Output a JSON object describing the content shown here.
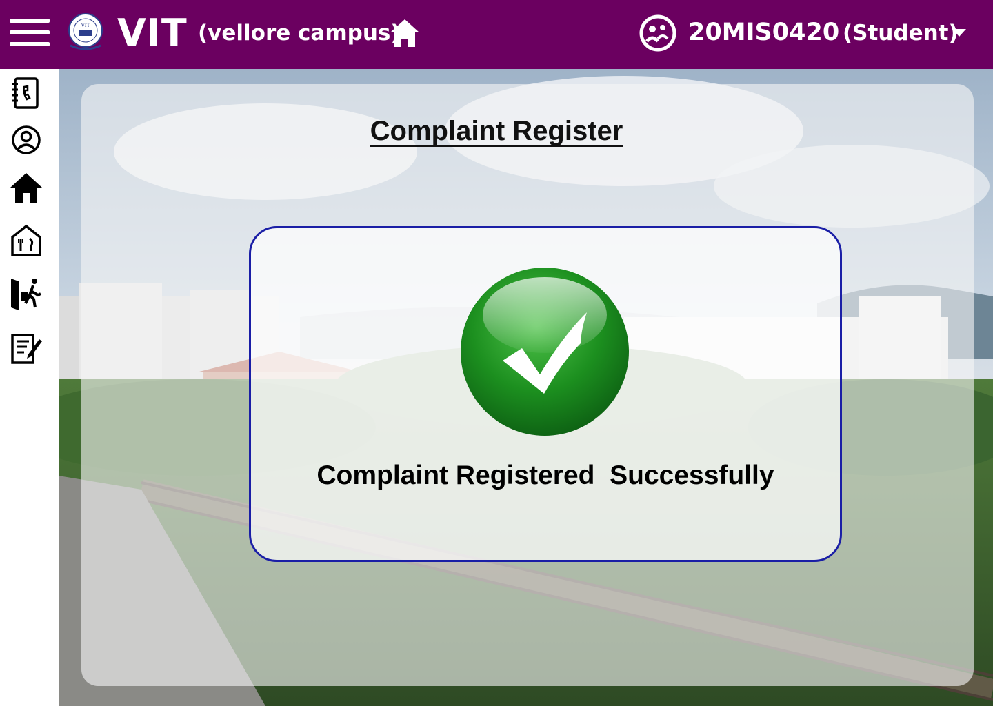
{
  "header": {
    "brand": "VIT",
    "campus": "(vellore campus)",
    "user_id": "20MIS0420",
    "user_role": "(Student)",
    "background_color": "#6b0060"
  },
  "sidebar": {
    "items": [
      {
        "icon": "contacts-book-icon"
      },
      {
        "icon": "profile-icon"
      },
      {
        "icon": "home-icon"
      },
      {
        "icon": "mess-icon"
      },
      {
        "icon": "leave-exit-icon"
      },
      {
        "icon": "complaint-form-icon"
      }
    ]
  },
  "main": {
    "title": "Complaint Register",
    "message": "Complaint Registered  Successfully",
    "status_icon": "success-check-icon",
    "accent_color": "#1a1ea6"
  }
}
